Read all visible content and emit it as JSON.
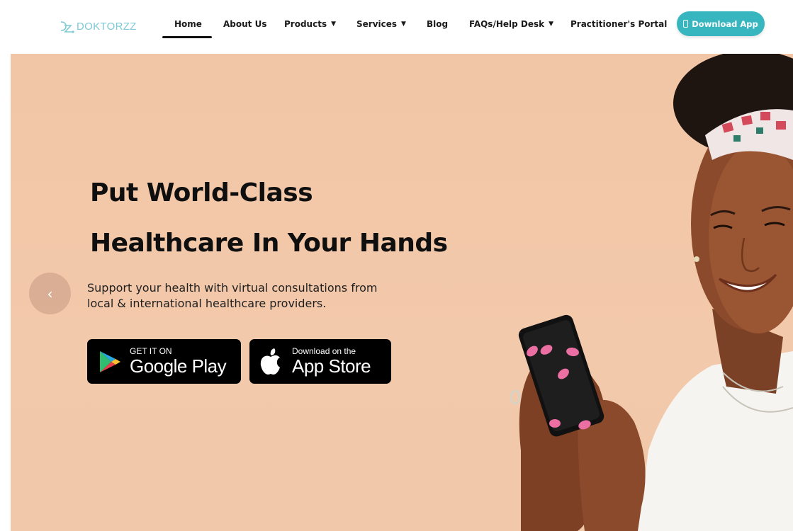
{
  "header": {
    "logo_text": "DOKTORZZ",
    "nav": {
      "home": "Home",
      "about": "About Us",
      "products": "Products",
      "services": "Services",
      "blog": "Blog",
      "faqs": "FAQs/Help Desk",
      "portal": "Practitioner's Portal"
    },
    "download_button": "Download App",
    "dropdown_icon": "caret-down-icon"
  },
  "hero": {
    "headline_line1": "Put World-Class",
    "headline_line2": "Healthcare In Your Hands",
    "subtext_line1": "Support your health with virtual consultations from",
    "subtext_line2": "local & international healthcare providers.",
    "prev_arrow": "‹",
    "google_play": {
      "small": "GET IT ON",
      "big": "Google Play"
    },
    "app_store": {
      "small": "Download on the",
      "big": "App Store"
    }
  },
  "colors": {
    "accent": "#38b6bf",
    "hero_background": "#f1c6a6",
    "logo": "#7ec9d3",
    "nail_pink": "#ec6fa3"
  }
}
